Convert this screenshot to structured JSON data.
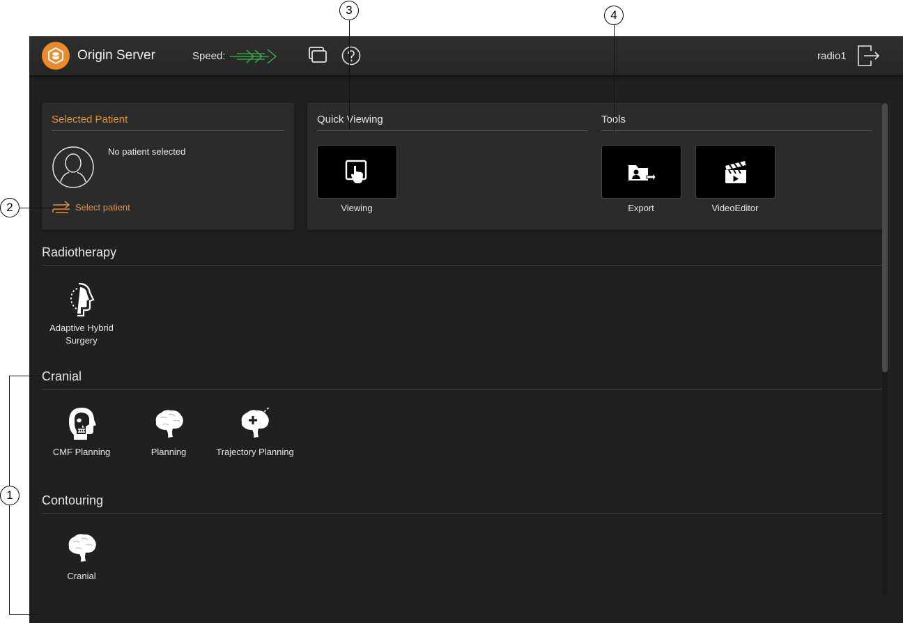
{
  "topbar": {
    "server_name": "Origin Server",
    "speed_label": "Speed:",
    "username": "radio1"
  },
  "patient": {
    "title": "Selected Patient",
    "status": "No patient selected",
    "select_label": "Select patient"
  },
  "quick_viewing": {
    "title": "Quick Viewing",
    "items": [
      {
        "label": "Viewing",
        "icon": "touch-screen-icon"
      }
    ]
  },
  "tools": {
    "title": "Tools",
    "items": [
      {
        "label": "Export",
        "icon": "export-folder-icon"
      },
      {
        "label": "VideoEditor",
        "icon": "clapperboard-icon"
      }
    ]
  },
  "groups": {
    "radiotherapy": {
      "title": "Radiotherapy",
      "items": [
        {
          "label": "Adaptive Hybrid Surgery",
          "icon": "head-profile-icon"
        }
      ]
    },
    "cranial": {
      "title": "Cranial",
      "items": [
        {
          "label": "CMF Planning",
          "icon": "skull-icon"
        },
        {
          "label": "Planning",
          "icon": "brain-icon"
        },
        {
          "label": "Trajectory Planning",
          "icon": "brain-trajectory-icon"
        }
      ]
    },
    "contouring": {
      "title": "Contouring",
      "items": [
        {
          "label": "Cranial",
          "icon": "brain-icon"
        }
      ]
    }
  },
  "callouts": [
    "1",
    "2",
    "3",
    "4"
  ],
  "colors": {
    "accent": "#e8922f",
    "background": "#202020",
    "panel": "#2b2b2b",
    "speed": "#3aa04a"
  }
}
